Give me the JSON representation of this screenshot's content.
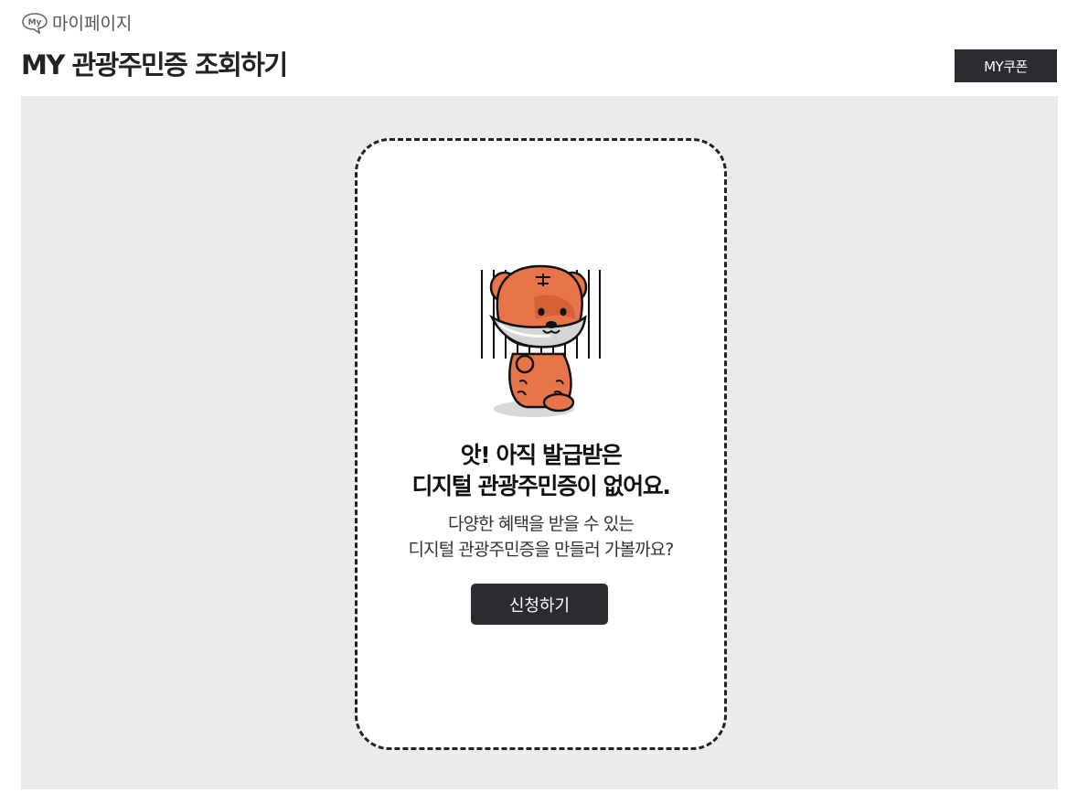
{
  "breadcrumb": {
    "icon": "my-speech-bubble-icon",
    "icon_text": "My",
    "label": "마이페이지"
  },
  "page": {
    "title": "MY 관광주민증 조회하기"
  },
  "header": {
    "coupon_button": "MY쿠폰"
  },
  "empty_state": {
    "illustration": "sad-tiger-behind-bars-icon",
    "headline_line1": "앗! 아직 발급받은",
    "headline_line2": "디지털 관광주민증이 없어요.",
    "sub_line1": "다양한 혜택을 받을 수 있는",
    "sub_line2": "디지털 관광주민증을 만들러 가볼까요?",
    "apply_button": "신청하기"
  },
  "colors": {
    "dark_button": "#2b2c30",
    "panel_bg": "#ebebeb",
    "tiger_orange": "#e8754a"
  }
}
